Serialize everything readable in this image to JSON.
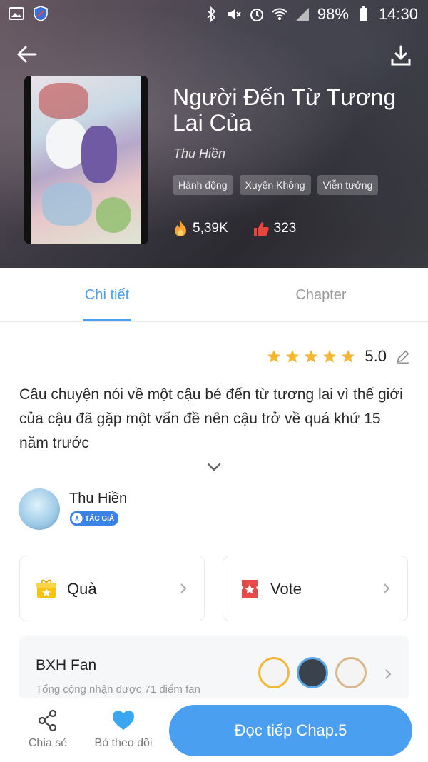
{
  "status_bar": {
    "battery": "98%",
    "time": "14:30"
  },
  "book": {
    "title": "Người Đến Từ Tương Lai Của",
    "author": "Thu Hiền",
    "tags": [
      "Hành động",
      "Xuyên Không",
      "Viễn tưởng"
    ],
    "views": "5,39K",
    "likes": "323"
  },
  "tabs": [
    {
      "label": "Chi tiết",
      "active": true
    },
    {
      "label": "Chapter",
      "active": false
    }
  ],
  "rating": {
    "stars": 5,
    "value": "5.0"
  },
  "description": "Câu chuyện nói về một cậu bé đến từ tương lai vì thế giới của cậu đã gặp một vấn đề nên cậu trở về quá khứ 15 năm trước",
  "author_card": {
    "name": "Thu Hiền",
    "badge": "TÁC GIẢ"
  },
  "actions": {
    "gift_label": "Quà",
    "vote_label": "Vote"
  },
  "fan_ranking": {
    "title": "BXH Fan",
    "subtitle": "Tổng cộng nhận được 71 điểm fan"
  },
  "bottom_bar": {
    "share_label": "Chia sẻ",
    "unfollow_label": "Bỏ theo dõi",
    "read_label": "Đọc tiếp Chap.5"
  },
  "colors": {
    "accent": "#4a9ff0",
    "star": "#f5b731",
    "vote": "#e84a4a"
  }
}
